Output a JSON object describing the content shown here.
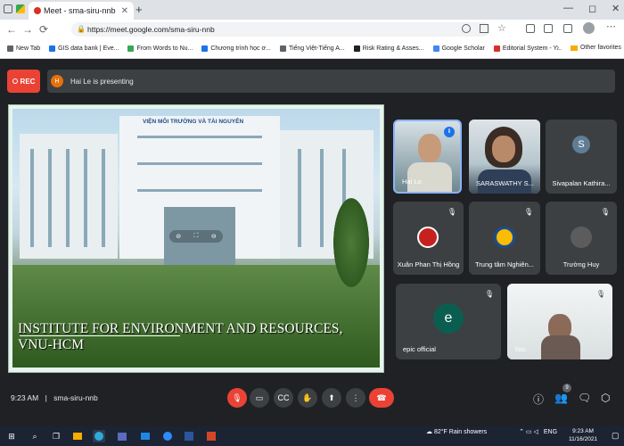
{
  "browser": {
    "tab_title": "Meet - sma-siru-nnb",
    "tab_close": "✕",
    "new_tab": "+",
    "url": "https://meet.google.com/sma-siru-nnb",
    "window_controls": [
      "—",
      "◻",
      "✕"
    ],
    "nav": {
      "back": "←",
      "forward": "→",
      "reload": "⟳",
      "more": "⋯"
    }
  },
  "bookmarks": [
    {
      "label": "New Tab",
      "icon": "page-icon"
    },
    {
      "label": "GIS data bank | Eve...",
      "icon": "bookmark-icon"
    },
    {
      "label": "From Words to Nu...",
      "icon": "bookmark-icon"
    },
    {
      "label": "Chương trình học ơ...",
      "icon": "bookmark-icon"
    },
    {
      "label": "Tiếng Việt-Tiếng A...",
      "icon": "bookmark-icon"
    },
    {
      "label": "Risk Rating & Asses...",
      "icon": "bookmark-icon"
    },
    {
      "label": "Google Scholar",
      "icon": "bookmark-icon"
    },
    {
      "label": "Editorial System - Y...",
      "icon": "bookmark-icon"
    }
  ],
  "bookmarks_more": "›",
  "other_favorites": "Other favorites",
  "meet": {
    "rec_label": "REC",
    "presenter_initial": "H",
    "presenting_text": "Hai Le is presenting",
    "slide_caption_line1": "INSTITUTE FOR ENVIRONMENT AND RESOURCES,",
    "slide_caption_line2": "VNU-HCM",
    "slide_sign": "VIỆN MÔI TRƯỜNG VÀ TÀI NGUYÊN",
    "tiles": {
      "hai": "Hai Lo",
      "saraswathy": "SARASWATHY S...",
      "sivapalan": "Sivapalan Kathira...",
      "sivapalan_initial": "S",
      "xuan": "Xuân Phan Thị Hồng",
      "trungtam": "Trung tâm Nghiên...",
      "truonghuy": "Trường Huy",
      "epic": "epic official",
      "epic_initial": "e",
      "you": "You"
    },
    "time": "9:23 AM",
    "meeting_code": "sma-siru-nnb",
    "people_count": "9",
    "accent_red": "#ea4335"
  },
  "taskbar": {
    "weather": "82°F  Rain showers",
    "lang": "ENG",
    "clock_time": "9:23 AM",
    "clock_date": "11/16/2021"
  }
}
